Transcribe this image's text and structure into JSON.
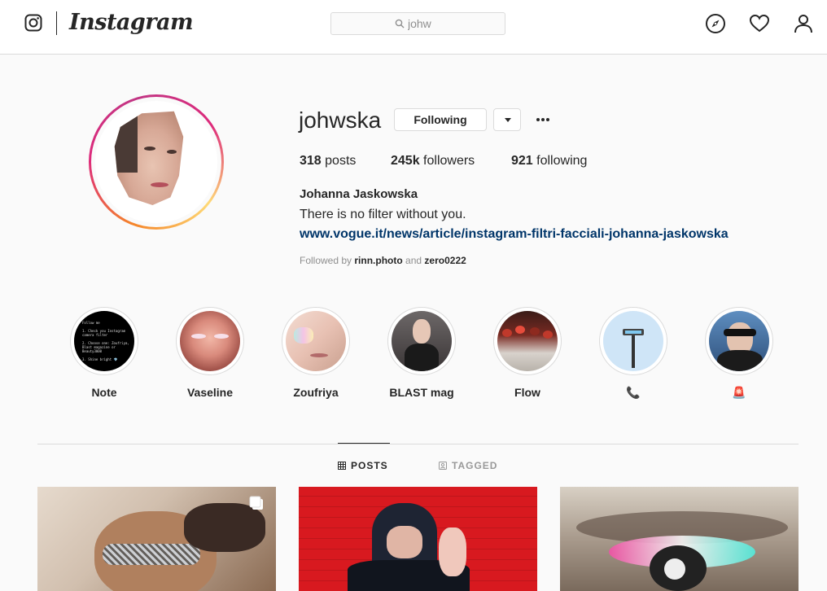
{
  "nav": {
    "brand": "Instagram",
    "search_value": "johw",
    "icons": [
      "instagram-glyph-icon",
      "search-icon",
      "explore-compass-icon",
      "activity-heart-icon",
      "profile-user-icon"
    ]
  },
  "profile": {
    "username": "johwska",
    "following_button": "Following",
    "stats": {
      "posts_count": "318",
      "posts_label": "posts",
      "followers_count": "245k",
      "followers_label": "followers",
      "following_count": "921",
      "following_label": "following"
    },
    "full_name": "Johanna Jaskowska",
    "bio": "There is no filter without you.",
    "link": "www.vogue.it/news/article/instagram-filtri-facciali-johanna-jaskowska",
    "followed_by_prefix": "Followed by",
    "followed_by_user1": "rinn.photo",
    "followed_by_and": "and",
    "followed_by_user2": "zero0222"
  },
  "highlights": [
    {
      "label": "Note"
    },
    {
      "label": "Vaseline"
    },
    {
      "label": "Zoufriya"
    },
    {
      "label": "BLAST mag"
    },
    {
      "label": "Flow"
    },
    {
      "label": "📞"
    },
    {
      "label": "🚨"
    }
  ],
  "note_text": [
    "Follow me",
    "1. Check you Instagram camera filter",
    "2. Choose one: Zoufriya, Blast magazine or Beauty3000",
    "3. Shine bright 💎"
  ],
  "tabs": {
    "posts": "POSTS",
    "tagged": "TAGGED"
  },
  "colors": {
    "link": "#003569",
    "border": "#dbdbdb",
    "text": "#262626",
    "muted": "#8e8e8e",
    "background": "#fafafa"
  }
}
